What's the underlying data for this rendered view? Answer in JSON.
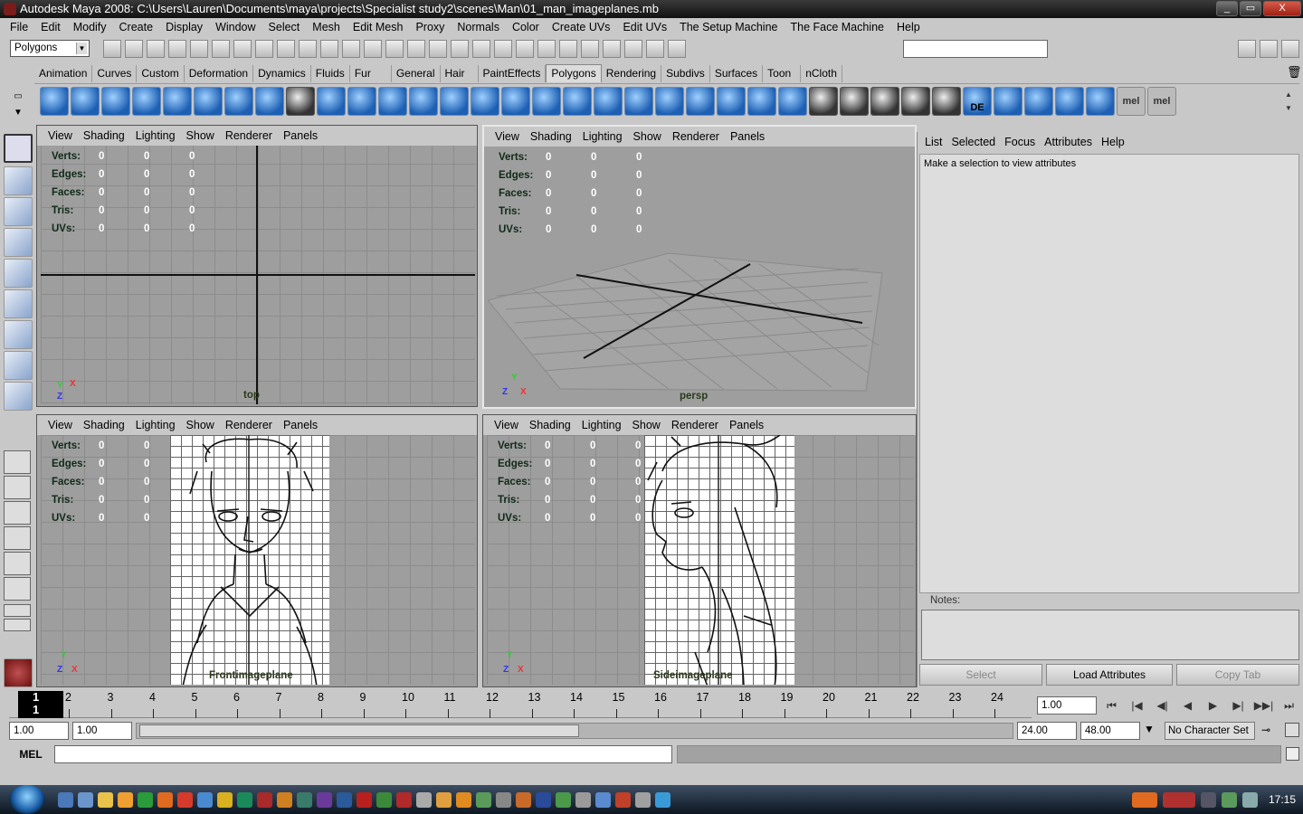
{
  "window": {
    "title": "Autodesk Maya 2008: C:\\Users\\Lauren\\Documents\\maya\\projects\\Specialist study2\\scenes\\Man\\01_man_imageplanes.mb",
    "buttons": [
      "_",
      "▭",
      "X"
    ]
  },
  "menubar": [
    "File",
    "Edit",
    "Modify",
    "Create",
    "Display",
    "Window",
    "Select",
    "Mesh",
    "Edit Mesh",
    "Proxy",
    "Normals",
    "Color",
    "Create UVs",
    "Edit UVs",
    "The Setup Machine",
    "The Face Machine",
    "Help"
  ],
  "status_line": {
    "menu_set": "Polygons",
    "input_value": ""
  },
  "shelf": {
    "tabs": [
      "Animation",
      "Curves",
      "Custom",
      "Deformation",
      "Dynamics",
      "Fluids",
      "Fur",
      "General",
      "Hair",
      "PaintEffects",
      "Polygons",
      "Rendering",
      "Subdivs",
      "Surfaces",
      "Toon",
      "nCloth"
    ],
    "active_tab": "Polygons",
    "icon_labels": {
      "de": "DE",
      "mel1": "mel",
      "mel2": "mel"
    }
  },
  "viewport_menu": [
    "View",
    "Shading",
    "Lighting",
    "Show",
    "Renderer",
    "Panels"
  ],
  "hud": {
    "labels": [
      "Verts:",
      "Edges:",
      "Faces:",
      "Tris:",
      "UVs:"
    ],
    "values": [
      "0",
      "0",
      "0"
    ]
  },
  "viewports": {
    "top": {
      "camera": "top"
    },
    "persp": {
      "camera": "persp"
    },
    "front": {
      "camera": "Frontimageplane"
    },
    "side": {
      "camera": "Sideimageplane"
    }
  },
  "axes": {
    "top": [
      "Y",
      "X",
      "Z"
    ],
    "persp": [
      "Y",
      "X",
      "Z"
    ],
    "front": [
      "Y",
      "Z",
      "X"
    ],
    "side": [
      "Y",
      "Z",
      "X"
    ]
  },
  "attribute_editor": {
    "menu": [
      "List",
      "Selected",
      "Focus",
      "Attributes",
      "Help"
    ],
    "message": "Make a selection to view attributes",
    "notes_label": "Notes:",
    "buttons": {
      "select": "Select",
      "load": "Load Attributes",
      "copy": "Copy Tab"
    }
  },
  "time_slider": {
    "current_frame": "1",
    "frames": [
      "2",
      "3",
      "4",
      "5",
      "6",
      "7",
      "8",
      "9",
      "10",
      "11",
      "12",
      "13",
      "14",
      "15",
      "16",
      "17",
      "18",
      "19",
      "20",
      "21",
      "22",
      "23",
      "24"
    ],
    "current_time_field": "1.00",
    "playback_glyphs": [
      "⏮",
      "|◀",
      "◀|",
      "◀",
      "▶",
      "▶|",
      "▶▶|",
      "⏭"
    ]
  },
  "range_slider": {
    "start_time": "1.00",
    "playback_start": "1.00",
    "playback_end": "24.00",
    "end_time": "48.00",
    "character_set": "No Character Set"
  },
  "command_line": {
    "label": "MEL",
    "value": ""
  },
  "taskbar": {
    "clock": "17:15"
  }
}
